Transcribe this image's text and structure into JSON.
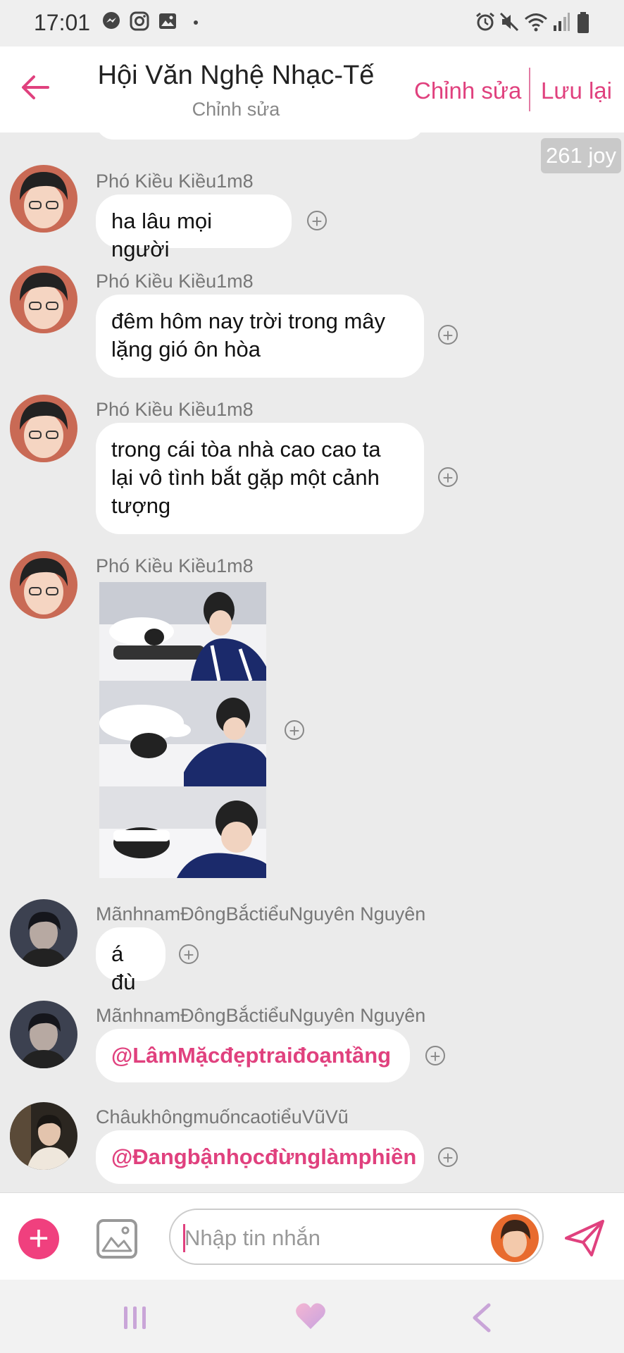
{
  "status_bar": {
    "time": "17:01",
    "left_icons": [
      "messenger-icon",
      "instagram-icon",
      "gallery-icon",
      "dot-icon"
    ],
    "right_icons": [
      "alarm-icon",
      "mute-icon",
      "wifi-icon",
      "signal-icon",
      "battery-icon"
    ]
  },
  "header": {
    "title": "Hội Văn Nghệ Nhạc-Tế",
    "subtitle": "Chỉnh sửa",
    "edit_label": "Chỉnh sửa",
    "save_label": "Lưu lại"
  },
  "joy_badge": "261 joy",
  "messages": [
    {
      "sender": "Phó Kiều Kiều1m8",
      "text": "ha lâu mọi người"
    },
    {
      "sender": "Phó Kiều Kiều1m8",
      "text": "đêm hôm nay trời trong mây lặng gió ôn hòa"
    },
    {
      "sender": "Phó Kiều Kiều1m8",
      "text": "trong cái tòa nhà cao cao ta lại vô tình bắt gặp  một cảnh tượng"
    },
    {
      "sender": "Phó Kiều Kiều1m8",
      "type": "image"
    },
    {
      "sender": "MãnhnamĐôngBắctiểuNguyên Nguyên",
      "text": "á đù"
    },
    {
      "sender": "MãnhnamĐôngBắctiểuNguyên Nguyên",
      "text": "@LâmMặcđẹptraiđoạntầng"
    },
    {
      "sender": "ChâukhôngmuốncaotiểuVũVũ",
      "text": "@Đangbậnhọcđừnglàmphiền"
    }
  ],
  "composer": {
    "placeholder": "Nhập tin nhắn"
  },
  "colors": {
    "accent": "#e0417e",
    "chat_background": "#ebebeb",
    "bubble": "#ffffff"
  }
}
